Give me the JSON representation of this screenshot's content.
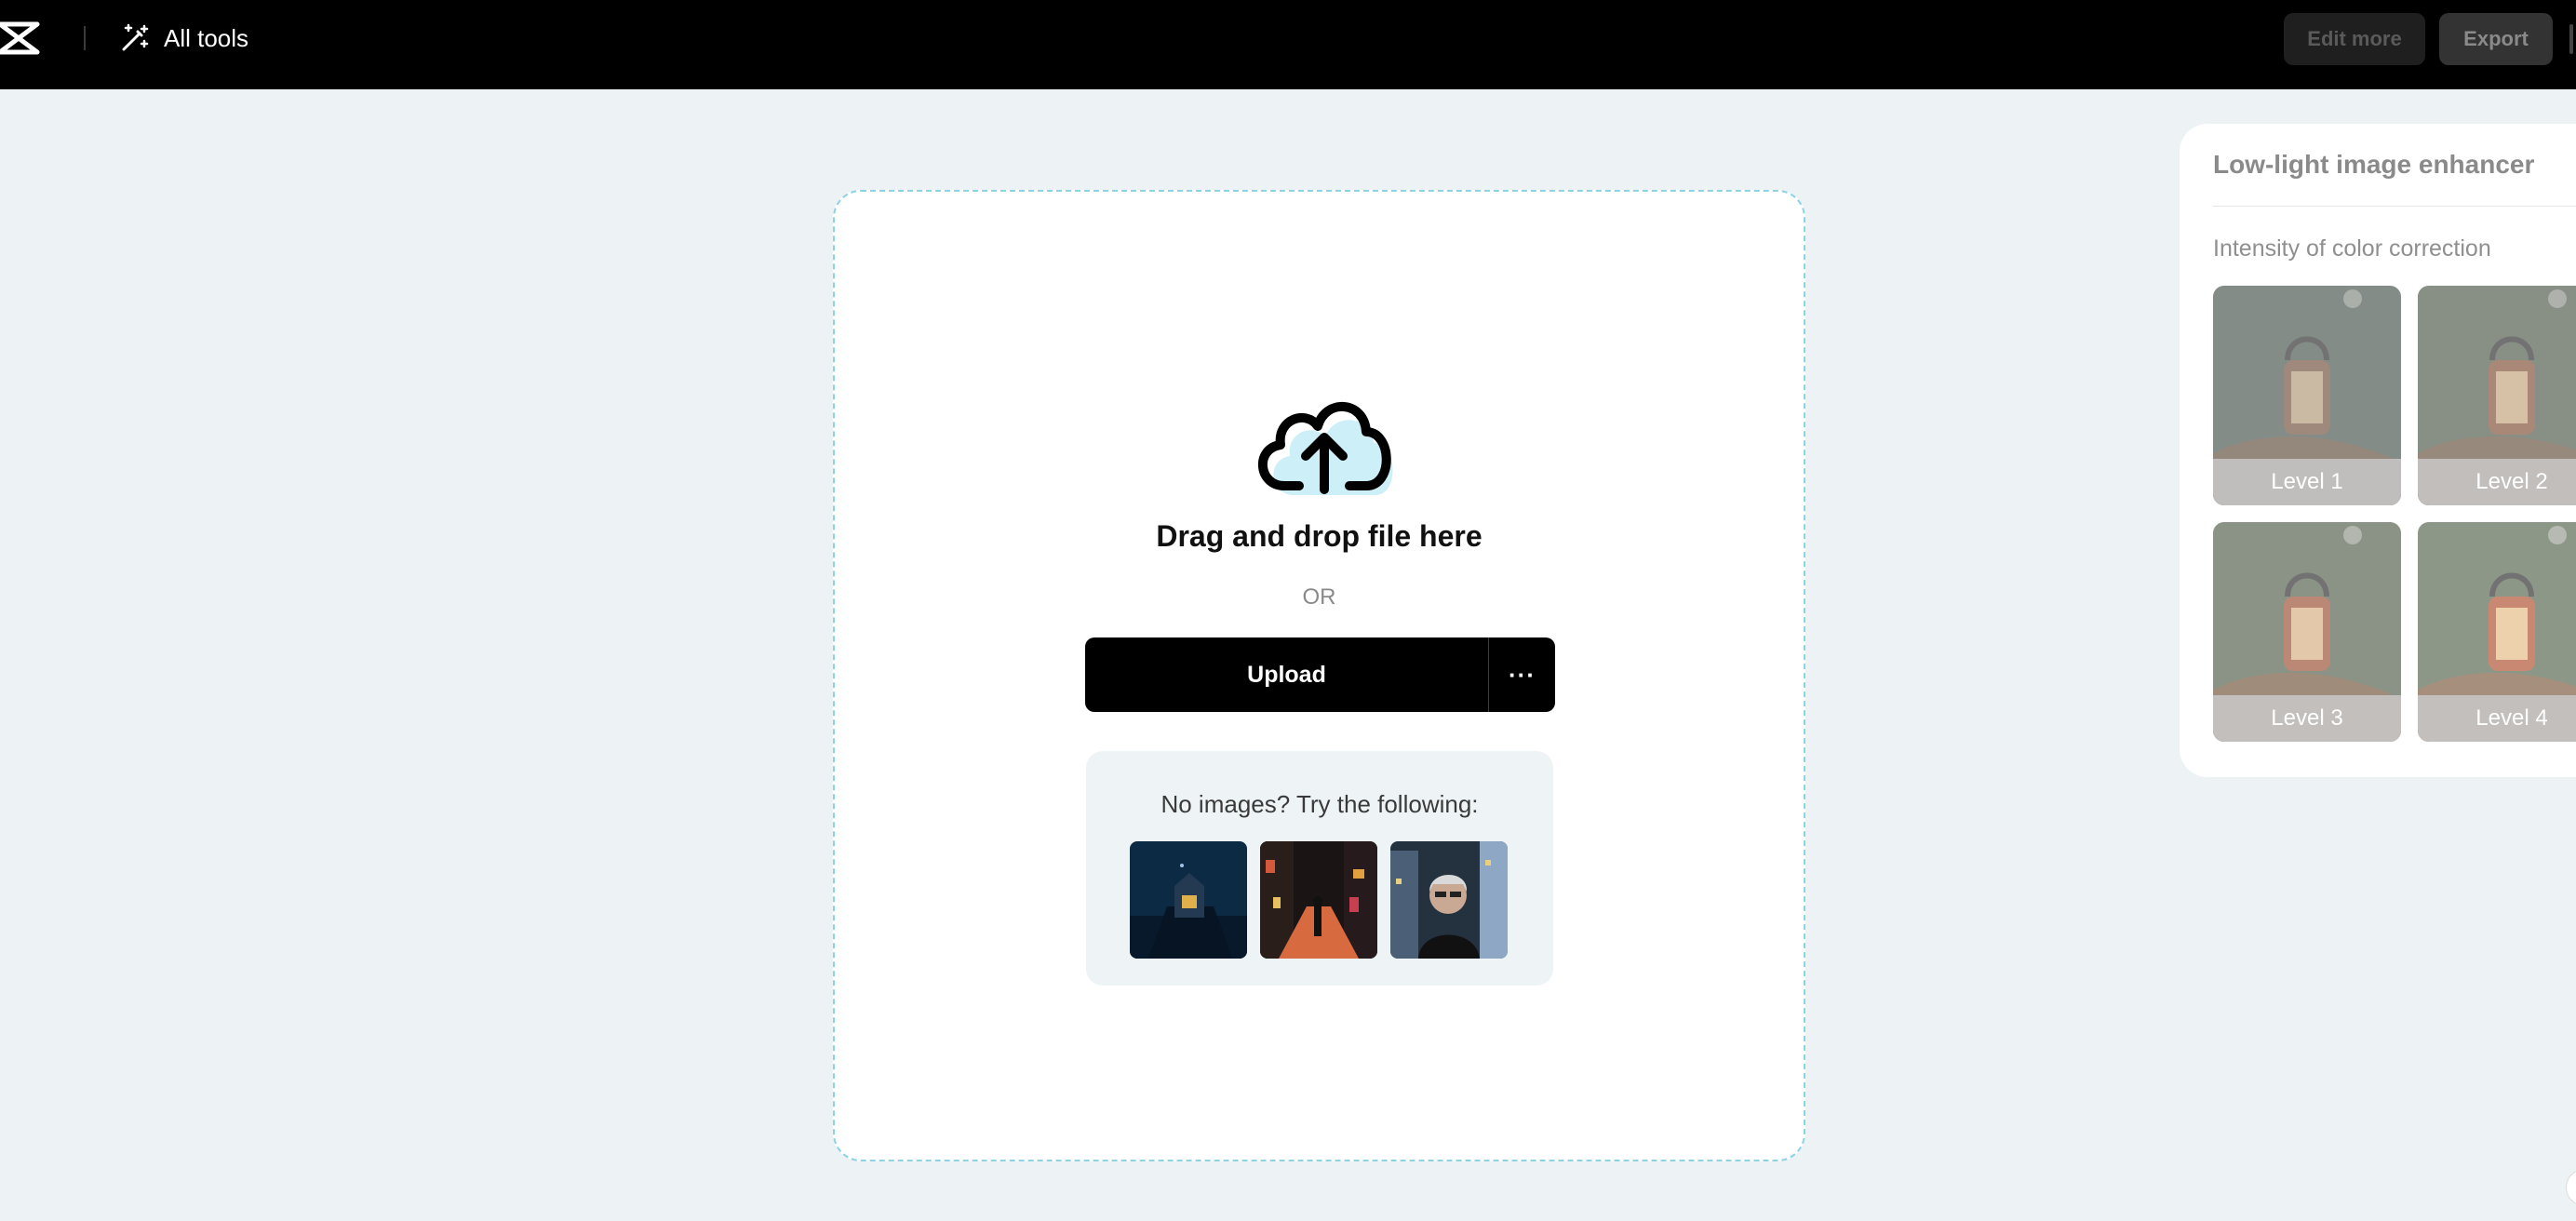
{
  "header": {
    "all_tools_label": "All tools",
    "edit_more_label": "Edit more",
    "export_label": "Export"
  },
  "upload": {
    "drag_title": "Drag and drop file here",
    "or_text": "OR",
    "upload_label": "Upload",
    "more_label": "···",
    "samples_label": "No images? Try the following:"
  },
  "panel": {
    "title": "Low-light image enhancer",
    "subtitle": "Intensity of color correction",
    "levels": [
      {
        "label": "Level 1"
      },
      {
        "label": "Level 2"
      },
      {
        "label": "Level 3"
      },
      {
        "label": "Level 4"
      }
    ]
  },
  "colors": {
    "topbar": "#000000",
    "page_bg": "#edf2f5",
    "dropzone_border": "#8dd3e6",
    "cloud_accent": "#cdeff7"
  }
}
